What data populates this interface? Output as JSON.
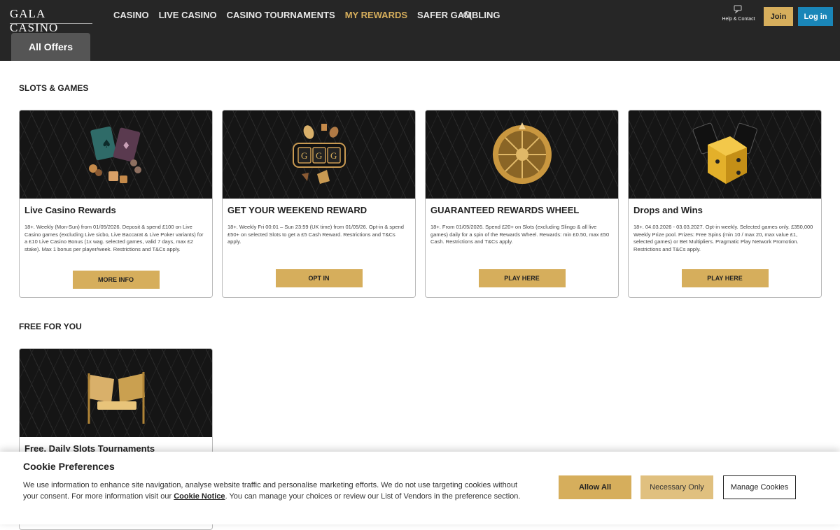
{
  "header": {
    "logo": "GALA CASINO",
    "nav": [
      {
        "label": "CASINO",
        "active": false
      },
      {
        "label": "LIVE CASINO",
        "active": false
      },
      {
        "label": "CASINO TOURNAMENTS",
        "active": false
      },
      {
        "label": "MY REWARDS",
        "active": true
      },
      {
        "label": "SAFER GAMBLING",
        "active": false
      }
    ],
    "help_label": "Help & Contact",
    "join_label": "Join",
    "login_label": "Log in",
    "tab_label": "All Offers"
  },
  "sections": [
    {
      "title": "SLOTS & GAMES",
      "cards": [
        {
          "title": "Live Casino Rewards",
          "text": "18+. Weekly (Mon-Sun) from 01/05/2026. Deposit & spend £100 on Live Casino games (excluding Live sicbo, Live Baccarat & Live Poker variants) for a £10 Live Casino Bonus (1x wag. selected games, valid 7 days, max £2 stake). Max 1 bonus per player/week. Restrictions and T&Cs apply.",
          "button": "MORE INFO",
          "art": "cards-chips-icon"
        },
        {
          "title": "GET YOUR WEEKEND REWARD",
          "text": "18+. Weekly Fri 00:01 – Sun 23:59 (UK time) from 01/05/26. Opt-in & spend £50+ on selected Slots to get a £5 Cash Reward. Restrictions and T&Cs apply.",
          "button": "OPT IN",
          "art": "slot-reels-icon"
        },
        {
          "title": "GUARANTEED REWARDS WHEEL",
          "text": "18+. From 01/05/2026. Spend £20+ on Slots (excluding Slingo & all live games) daily for a spin of the Rewards Wheel. Rewards: min £0.50, max £50 Cash. Restrictions and T&Cs apply.",
          "button": "PLAY HERE",
          "art": "rewards-wheel-icon"
        },
        {
          "title": "Drops and Wins",
          "text": "18+. 04.03.2026 - 03.03.2027. Opt-in weekly. Selected games only. £350,000 Weekly Prize pool. Prizes: Free Spins (min 10 / max 20, max value £1, selected games) or Bet Multipliers. Pragmatic Play Network Promotion. Restrictions and T&Cs apply.",
          "button": "PLAY HERE",
          "art": "dice-icon"
        }
      ]
    },
    {
      "title": "FREE FOR YOU",
      "cards": [
        {
          "title": "Free, Daily Slots Tournaments",
          "text": "",
          "button": "",
          "art": "flags-icon"
        }
      ]
    }
  ],
  "cookie": {
    "title": "Cookie Preferences",
    "text_before": "We use information to enhance site navigation, analyse website traffic and personalise marketing efforts. We do not use targeting cookies without your consent. For more information visit our ",
    "link": "Cookie Notice",
    "text_after": ". You can manage your choices or review our List of Vendors in the preference section.",
    "allow": "Allow All",
    "necessary": "Necessary Only",
    "manage": "Manage Cookies"
  },
  "colors": {
    "gold": "#d6ae5c",
    "blue": "#1a86b8",
    "dark": "#262626"
  }
}
